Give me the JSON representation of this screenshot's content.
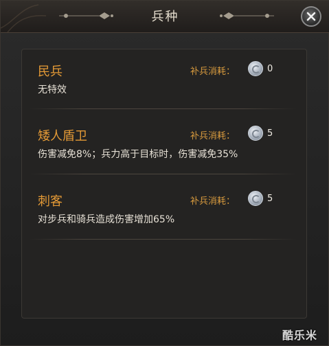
{
  "window": {
    "title": "兵种"
  },
  "units": [
    {
      "name": "民兵",
      "description": "无特效",
      "cost_label": "补兵消耗：",
      "cost": "0"
    },
    {
      "name": "矮人盾卫",
      "description": "伤害减免8%；兵力高于目标时，伤害减免35%",
      "cost_label": "补兵消耗：",
      "cost": "5"
    },
    {
      "name": "刺客",
      "description": "对步兵和骑兵造成伤害增加65%",
      "cost_label": "补兵消耗：",
      "cost": "5"
    }
  ],
  "watermark": "酷乐米",
  "icons": {
    "close": "close-icon",
    "coin": "silver-coin-icon"
  },
  "colors": {
    "unit_name": "#e49a36",
    "cost_label": "#d79a3e",
    "text": "#e7e1d6"
  }
}
